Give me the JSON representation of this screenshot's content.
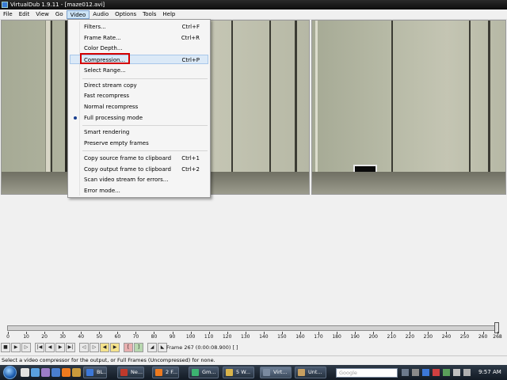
{
  "window": {
    "title": "VirtualDub 1.9.11 - [maze012.avi]"
  },
  "menubar": {
    "items": [
      "File",
      "Edit",
      "View",
      "Go",
      "Video",
      "Audio",
      "Options",
      "Tools",
      "Help"
    ],
    "open": "Video"
  },
  "video_menu": {
    "filters": {
      "label": "Filters...",
      "shortcut": "Ctrl+F"
    },
    "frame_rate": {
      "label": "Frame Rate...",
      "shortcut": "Ctrl+R"
    },
    "color_depth": {
      "label": "Color Depth..."
    },
    "compression": {
      "label": "Compression...",
      "shortcut": "Ctrl+P"
    },
    "select_range": {
      "label": "Select Range..."
    },
    "direct_stream_copy": {
      "label": "Direct stream copy"
    },
    "fast_recompress": {
      "label": "Fast recompress"
    },
    "normal_recompress": {
      "label": "Normal recompress"
    },
    "full_processing_mode": {
      "label": "Full processing mode",
      "checked": true
    },
    "smart_rendering": {
      "label": "Smart rendering"
    },
    "preserve_empty_frames": {
      "label": "Preserve empty frames"
    },
    "copy_source_frame": {
      "label": "Copy source frame to clipboard",
      "shortcut": "Ctrl+1"
    },
    "copy_output_frame": {
      "label": "Copy output frame to clipboard",
      "shortcut": "Ctrl+2"
    },
    "scan_stream": {
      "label": "Scan video stream for errors..."
    },
    "error_mode": {
      "label": "Error mode..."
    }
  },
  "timeline": {
    "tick_labels": [
      "0",
      "10",
      "20",
      "30",
      "40",
      "50",
      "60",
      "70",
      "80",
      "90",
      "100",
      "110",
      "120",
      "130",
      "140",
      "150",
      "160",
      "170",
      "180",
      "190",
      "200",
      "210",
      "220",
      "230",
      "240",
      "250",
      "260",
      "268"
    ],
    "position_fraction": 1.0
  },
  "position_readout": "Frame 267 (0:00:08.900) [ ]",
  "status_text": "Select a video compressor for the output, or Full Frames (Uncompressed) for none.",
  "taskbar": {
    "tasks": [
      "BL...",
      "Ne...",
      "2 F...",
      "Gm...",
      "5 W...",
      "Virt...",
      "Unt..."
    ],
    "search_placeholder": "Google",
    "clock": "9:57 AM"
  },
  "colors": {
    "highlight_box": "#d40000",
    "taskbar": "#1b2531",
    "menu_hover": "#dbe9f7"
  }
}
